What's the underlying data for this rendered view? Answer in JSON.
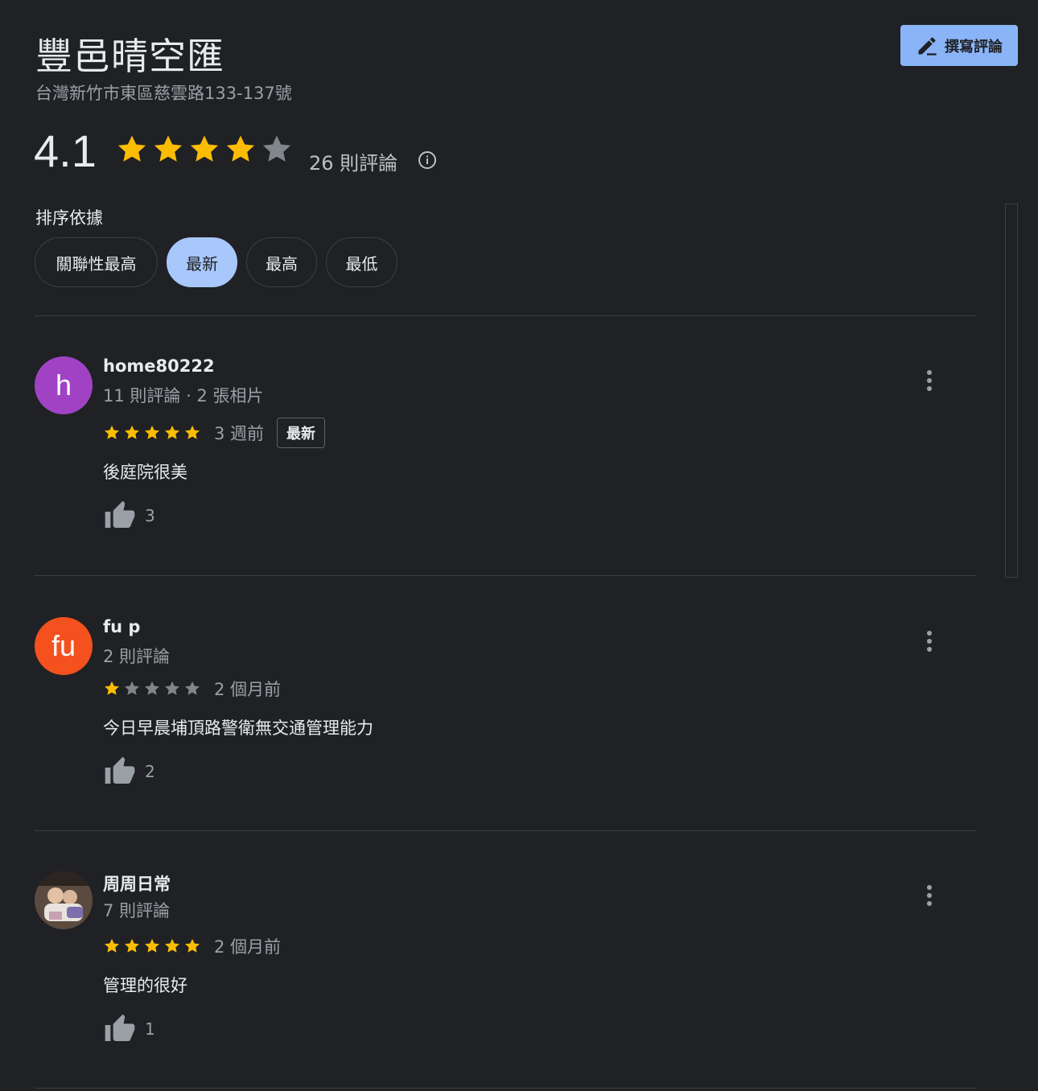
{
  "place": {
    "title": "豐邑晴空匯",
    "address": "台灣新竹市東區慈雲路133-137號"
  },
  "write_review": {
    "label": "撰寫評論",
    "icon": "pencil-icon"
  },
  "summary": {
    "rating": "4.1",
    "rating_value": 4.1,
    "review_count": "26 則評論",
    "star_color": "#fbbc04",
    "empty_star_color": "#80868b"
  },
  "sort": {
    "label": "排序依據",
    "options": [
      "關聯性最高",
      "最新",
      "最高",
      "最低"
    ],
    "selected": "最新"
  },
  "reviews": [
    {
      "name": "home80222",
      "meta": "11 則評論 · 2 張相片",
      "avatar_letter": "h",
      "avatar_color": "#a142c4",
      "stars": 5,
      "time": "3 週前",
      "badge": "最新",
      "text": "後庭院很美",
      "likes": "3"
    },
    {
      "name": "fu p",
      "meta": "2 則評論",
      "avatar_letter": "fu",
      "avatar_color": "#f4511e",
      "stars": 1,
      "time": "2 個月前",
      "text": "今日早晨埔頂路警衛無交通管理能力",
      "likes": "2"
    },
    {
      "name": "周周日常",
      "meta": "7 則評論",
      "avatar_letter": "",
      "avatar_color": "#6d5b4b",
      "stars": 5,
      "time": "2 個月前",
      "text": "管理的很好",
      "likes": "1"
    }
  ]
}
